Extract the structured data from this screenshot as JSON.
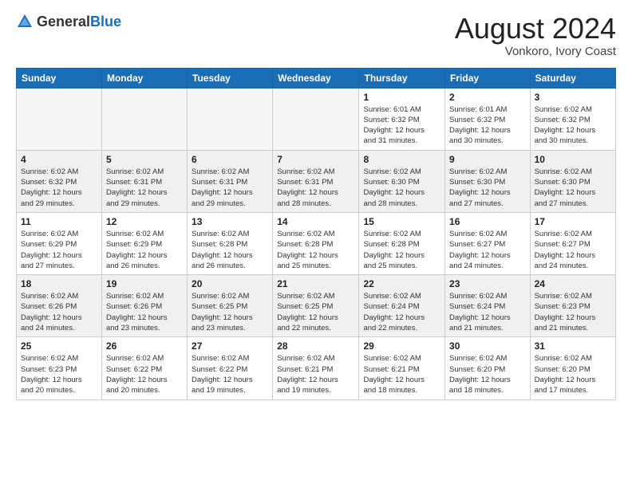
{
  "header": {
    "logo_general": "General",
    "logo_blue": "Blue",
    "month_year": "August 2024",
    "location": "Vonkoro, Ivory Coast"
  },
  "weekdays": [
    "Sunday",
    "Monday",
    "Tuesday",
    "Wednesday",
    "Thursday",
    "Friday",
    "Saturday"
  ],
  "weeks": [
    [
      {
        "day": "",
        "info": "",
        "empty": true
      },
      {
        "day": "",
        "info": "",
        "empty": true
      },
      {
        "day": "",
        "info": "",
        "empty": true
      },
      {
        "day": "",
        "info": "",
        "empty": true
      },
      {
        "day": "1",
        "info": "Sunrise: 6:01 AM\nSunset: 6:32 PM\nDaylight: 12 hours\nand 31 minutes.",
        "empty": false
      },
      {
        "day": "2",
        "info": "Sunrise: 6:01 AM\nSunset: 6:32 PM\nDaylight: 12 hours\nand 30 minutes.",
        "empty": false
      },
      {
        "day": "3",
        "info": "Sunrise: 6:02 AM\nSunset: 6:32 PM\nDaylight: 12 hours\nand 30 minutes.",
        "empty": false
      }
    ],
    [
      {
        "day": "4",
        "info": "Sunrise: 6:02 AM\nSunset: 6:32 PM\nDaylight: 12 hours\nand 29 minutes.",
        "empty": false
      },
      {
        "day": "5",
        "info": "Sunrise: 6:02 AM\nSunset: 6:31 PM\nDaylight: 12 hours\nand 29 minutes.",
        "empty": false
      },
      {
        "day": "6",
        "info": "Sunrise: 6:02 AM\nSunset: 6:31 PM\nDaylight: 12 hours\nand 29 minutes.",
        "empty": false
      },
      {
        "day": "7",
        "info": "Sunrise: 6:02 AM\nSunset: 6:31 PM\nDaylight: 12 hours\nand 28 minutes.",
        "empty": false
      },
      {
        "day": "8",
        "info": "Sunrise: 6:02 AM\nSunset: 6:30 PM\nDaylight: 12 hours\nand 28 minutes.",
        "empty": false
      },
      {
        "day": "9",
        "info": "Sunrise: 6:02 AM\nSunset: 6:30 PM\nDaylight: 12 hours\nand 27 minutes.",
        "empty": false
      },
      {
        "day": "10",
        "info": "Sunrise: 6:02 AM\nSunset: 6:30 PM\nDaylight: 12 hours\nand 27 minutes.",
        "empty": false
      }
    ],
    [
      {
        "day": "11",
        "info": "Sunrise: 6:02 AM\nSunset: 6:29 PM\nDaylight: 12 hours\nand 27 minutes.",
        "empty": false
      },
      {
        "day": "12",
        "info": "Sunrise: 6:02 AM\nSunset: 6:29 PM\nDaylight: 12 hours\nand 26 minutes.",
        "empty": false
      },
      {
        "day": "13",
        "info": "Sunrise: 6:02 AM\nSunset: 6:28 PM\nDaylight: 12 hours\nand 26 minutes.",
        "empty": false
      },
      {
        "day": "14",
        "info": "Sunrise: 6:02 AM\nSunset: 6:28 PM\nDaylight: 12 hours\nand 25 minutes.",
        "empty": false
      },
      {
        "day": "15",
        "info": "Sunrise: 6:02 AM\nSunset: 6:28 PM\nDaylight: 12 hours\nand 25 minutes.",
        "empty": false
      },
      {
        "day": "16",
        "info": "Sunrise: 6:02 AM\nSunset: 6:27 PM\nDaylight: 12 hours\nand 24 minutes.",
        "empty": false
      },
      {
        "day": "17",
        "info": "Sunrise: 6:02 AM\nSunset: 6:27 PM\nDaylight: 12 hours\nand 24 minutes.",
        "empty": false
      }
    ],
    [
      {
        "day": "18",
        "info": "Sunrise: 6:02 AM\nSunset: 6:26 PM\nDaylight: 12 hours\nand 24 minutes.",
        "empty": false
      },
      {
        "day": "19",
        "info": "Sunrise: 6:02 AM\nSunset: 6:26 PM\nDaylight: 12 hours\nand 23 minutes.",
        "empty": false
      },
      {
        "day": "20",
        "info": "Sunrise: 6:02 AM\nSunset: 6:25 PM\nDaylight: 12 hours\nand 23 minutes.",
        "empty": false
      },
      {
        "day": "21",
        "info": "Sunrise: 6:02 AM\nSunset: 6:25 PM\nDaylight: 12 hours\nand 22 minutes.",
        "empty": false
      },
      {
        "day": "22",
        "info": "Sunrise: 6:02 AM\nSunset: 6:24 PM\nDaylight: 12 hours\nand 22 minutes.",
        "empty": false
      },
      {
        "day": "23",
        "info": "Sunrise: 6:02 AM\nSunset: 6:24 PM\nDaylight: 12 hours\nand 21 minutes.",
        "empty": false
      },
      {
        "day": "24",
        "info": "Sunrise: 6:02 AM\nSunset: 6:23 PM\nDaylight: 12 hours\nand 21 minutes.",
        "empty": false
      }
    ],
    [
      {
        "day": "25",
        "info": "Sunrise: 6:02 AM\nSunset: 6:23 PM\nDaylight: 12 hours\nand 20 minutes.",
        "empty": false
      },
      {
        "day": "26",
        "info": "Sunrise: 6:02 AM\nSunset: 6:22 PM\nDaylight: 12 hours\nand 20 minutes.",
        "empty": false
      },
      {
        "day": "27",
        "info": "Sunrise: 6:02 AM\nSunset: 6:22 PM\nDaylight: 12 hours\nand 19 minutes.",
        "empty": false
      },
      {
        "day": "28",
        "info": "Sunrise: 6:02 AM\nSunset: 6:21 PM\nDaylight: 12 hours\nand 19 minutes.",
        "empty": false
      },
      {
        "day": "29",
        "info": "Sunrise: 6:02 AM\nSunset: 6:21 PM\nDaylight: 12 hours\nand 18 minutes.",
        "empty": false
      },
      {
        "day": "30",
        "info": "Sunrise: 6:02 AM\nSunset: 6:20 PM\nDaylight: 12 hours\nand 18 minutes.",
        "empty": false
      },
      {
        "day": "31",
        "info": "Sunrise: 6:02 AM\nSunset: 6:20 PM\nDaylight: 12 hours\nand 17 minutes.",
        "empty": false
      }
    ]
  ]
}
